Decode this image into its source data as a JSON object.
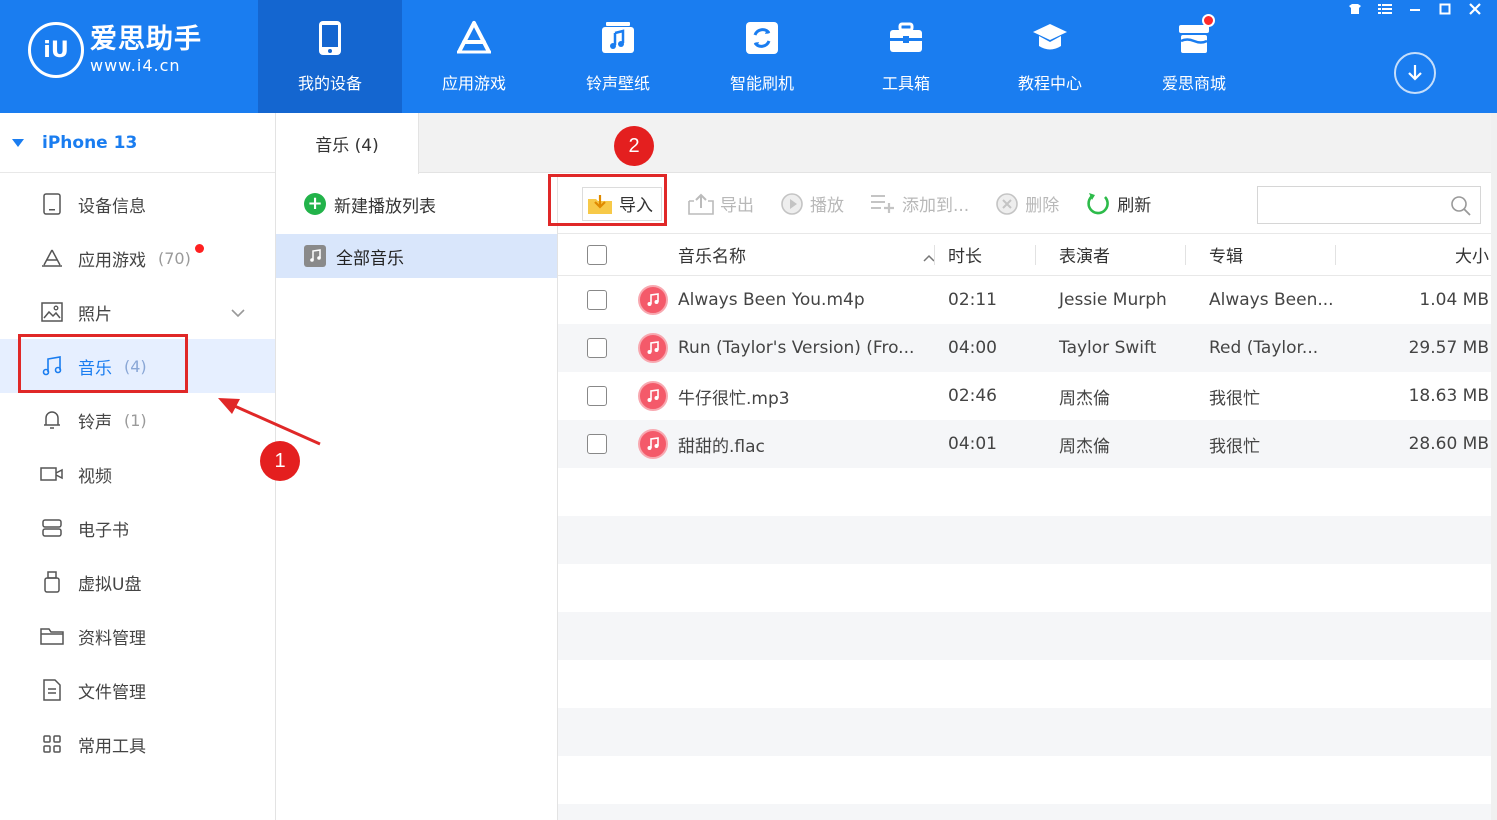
{
  "app": {
    "logo_mark": "iU",
    "logo_name": "爱思助手",
    "logo_url": "www.i4.cn"
  },
  "nav": [
    {
      "label": "我的设备",
      "icon": "phone-icon",
      "active": true
    },
    {
      "label": "应用游戏",
      "icon": "app-store-icon"
    },
    {
      "label": "铃声壁纸",
      "icon": "music-wallpaper-icon"
    },
    {
      "label": "智能刷机",
      "icon": "flash-icon"
    },
    {
      "label": "工具箱",
      "icon": "toolbox-icon"
    },
    {
      "label": "教程中心",
      "icon": "graduation-cap-icon"
    },
    {
      "label": "爱思商城",
      "icon": "store-icon",
      "badge": true
    }
  ],
  "device": {
    "name": "iPhone 13"
  },
  "sidebar": [
    {
      "label": "设备信息",
      "icon": "device-info-icon"
    },
    {
      "label": "应用游戏",
      "count": "(70)",
      "icon": "apps-icon",
      "dot": true
    },
    {
      "label": "照片",
      "icon": "photo-icon",
      "chevron": true
    },
    {
      "label": "音乐",
      "count": "(4)",
      "icon": "music-note-icon",
      "active": true
    },
    {
      "label": "铃声",
      "count": "(1)",
      "icon": "bell-icon"
    },
    {
      "label": "视频",
      "icon": "video-icon"
    },
    {
      "label": "电子书",
      "icon": "ebook-icon"
    },
    {
      "label": "虚拟U盘",
      "icon": "usb-drive-icon"
    },
    {
      "label": "资料管理",
      "icon": "folder-icon"
    },
    {
      "label": "文件管理",
      "icon": "file-icon"
    },
    {
      "label": "常用工具",
      "icon": "grid-tools-icon"
    }
  ],
  "music_tab": {
    "label": "音乐 (4)"
  },
  "playlist": {
    "new_label": "新建播放列表",
    "all_label": "全部音乐"
  },
  "toolbar": {
    "import": "导入",
    "export": "导出",
    "play": "播放",
    "add_to": "添加到...",
    "delete": "删除",
    "refresh": "刷新",
    "search_placeholder": ""
  },
  "table": {
    "headers": {
      "name": "音乐名称",
      "duration": "时长",
      "artist": "表演者",
      "album": "专辑",
      "size": "大小"
    },
    "rows": [
      {
        "name": "Always Been You.m4p",
        "duration": "02:11",
        "artist": "Jessie Murph",
        "album": "Always Been...",
        "size": "1.04 MB"
      },
      {
        "name": "Run (Taylor's Version) (Fro...",
        "duration": "04:00",
        "artist": "Taylor Swift",
        "album": "Red (Taylor...",
        "size": "29.57 MB"
      },
      {
        "name": "牛仔很忙.mp3",
        "duration": "02:46",
        "artist": "周杰倫",
        "album": "我很忙",
        "size": "18.63 MB"
      },
      {
        "name": "甜甜的.flac",
        "duration": "04:01",
        "artist": "周杰倫",
        "album": "我很忙",
        "size": "28.60 MB"
      }
    ]
  },
  "annotations": {
    "step1": "1",
    "step2": "2"
  },
  "colors": {
    "brand_blue": "#1a7df0",
    "annotation_red": "#e02828",
    "music_badge": "#f45a6a"
  }
}
